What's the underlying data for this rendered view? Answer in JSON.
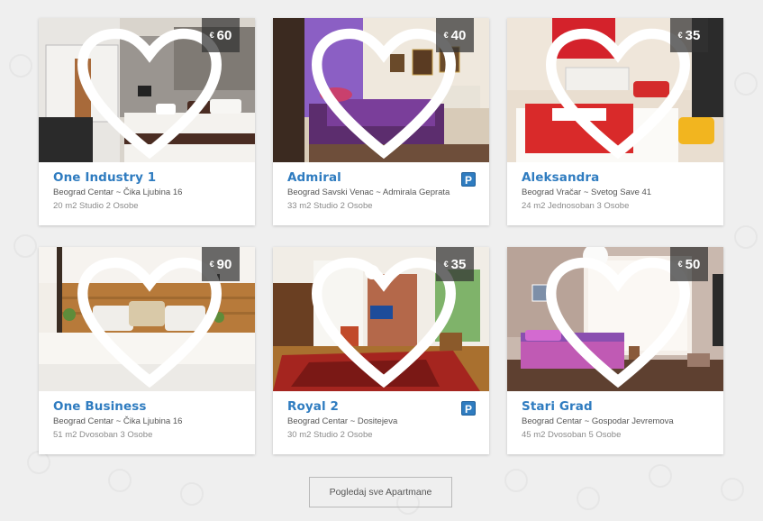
{
  "apartments": [
    {
      "name": "One Industry 1",
      "currency": "€",
      "price": "60",
      "address": "Beograd Centar ~ Čika Ljubina 16",
      "specs": "20 m2 Studio 2 Osobe",
      "parking": false
    },
    {
      "name": "Admiral",
      "currency": "€",
      "price": "40",
      "address": "Beograd Savski Venac ~ Admirala Geprata",
      "specs": "33 m2 Studio 2 Osobe",
      "parking": true,
      "parking_label": "P"
    },
    {
      "name": "Aleksandra",
      "currency": "€",
      "price": "35",
      "address": "Beograd Vračar ~ Svetog Save 41",
      "specs": "24 m2 Jednosoban 3 Osobe",
      "parking": false
    },
    {
      "name": "One Business",
      "currency": "€",
      "price": "90",
      "address": "Beograd Centar ~ Čika Ljubina 16",
      "specs": "51 m2 Dvosoban 3 Osobe",
      "parking": false
    },
    {
      "name": "Royal 2",
      "currency": "€",
      "price": "35",
      "address": "Beograd Centar ~ Dositejeva",
      "specs": "30 m2 Studio 2 Osobe",
      "parking": true,
      "parking_label": "P"
    },
    {
      "name": "Stari Grad",
      "currency": "€",
      "price": "50",
      "address": "Beograd Centar ~ Gospodar Jevremova",
      "specs": "45 m2 Dvosoban 5 Osobe",
      "parking": false
    }
  ],
  "view_all_label": "Pogledaj sve Apartmane",
  "colors": {
    "accent": "#2f7cc0",
    "background": "#efefef",
    "price_badge": "#323232"
  }
}
